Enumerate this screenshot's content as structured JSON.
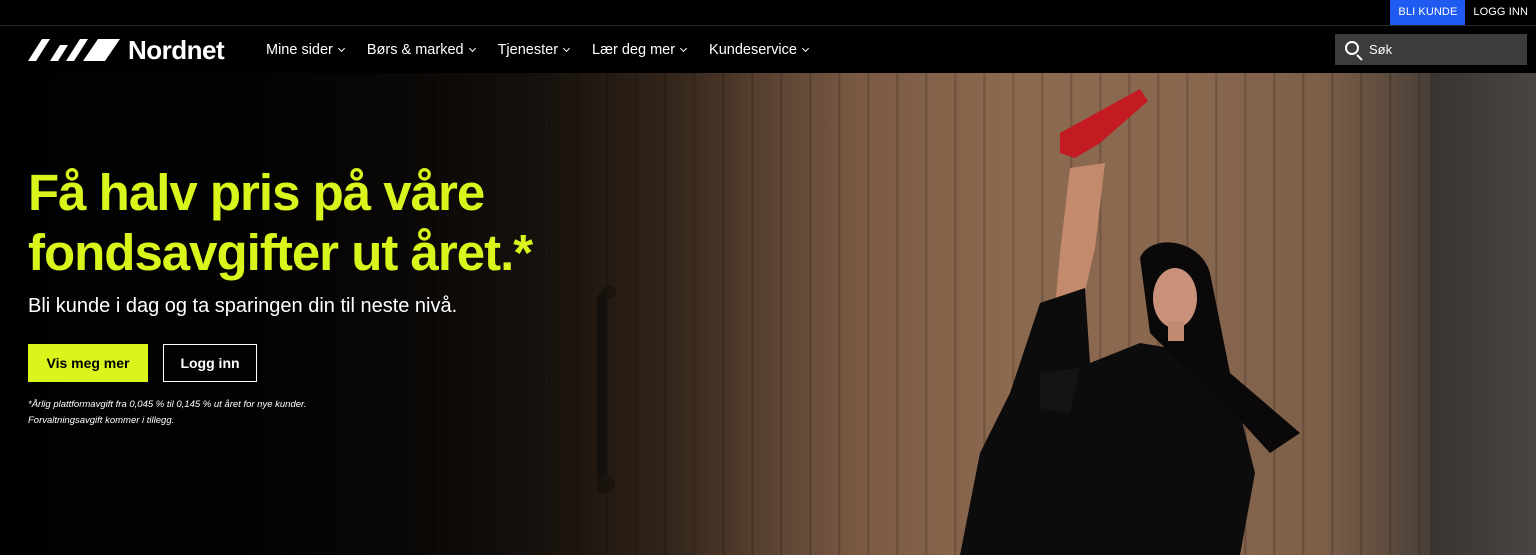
{
  "utility": {
    "become_customer": "BLI KUNDE",
    "login": "LOGG INN"
  },
  "brand": {
    "name": "Nordnet",
    "accent_color": "#d9f51c",
    "link_color": "#1f5bf0"
  },
  "nav": {
    "items": [
      {
        "label": "Mine sider"
      },
      {
        "label": "Børs & marked"
      },
      {
        "label": "Tjenester"
      },
      {
        "label": "Lær deg mer"
      },
      {
        "label": "Kundeservice"
      }
    ]
  },
  "search": {
    "label": "Søk"
  },
  "hero": {
    "headline_line1": "Få halv pris på våre",
    "headline_line2": "fondsavgifter ut året.*",
    "subline": "Bli kunde i dag og ta sparingen din til neste nivå.",
    "cta_primary": "Vis meg mer",
    "cta_secondary": "Logg inn",
    "footnote_line1": "*Årlig plattformavgift fra 0,045 % til 0,145 % ut året for nye kunder.",
    "footnote_line2": "Forvaltningsavgift kommer i tillegg."
  }
}
